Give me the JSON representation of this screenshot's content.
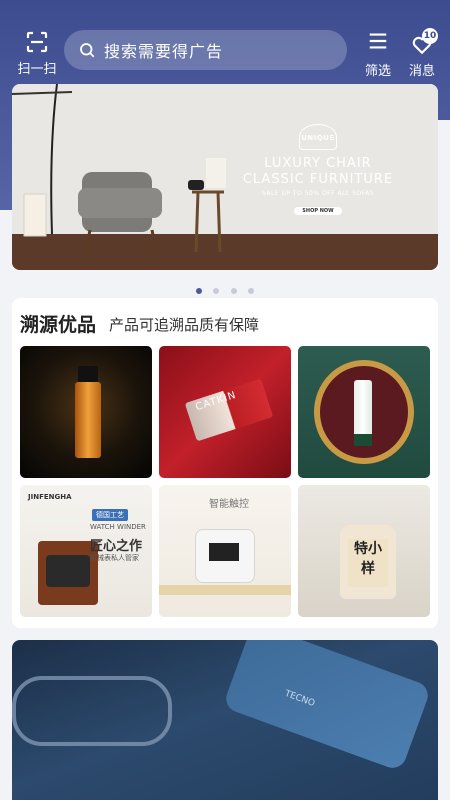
{
  "header": {
    "scan_label": "扫一扫",
    "search_placeholder": "搜索需要得广告",
    "filter_label": "筛选",
    "message_label": "消息",
    "message_badge": "10"
  },
  "banner": {
    "badge_text": "UNIQUE",
    "line1": "LUXURY CHAIR",
    "line2": "CLASSIC FURNITURE",
    "subline": "SALE UP TO 50% OFF ALL SOFAS",
    "button": "SHOP NOW",
    "dots_total": 4,
    "dots_active": 1
  },
  "section": {
    "title": "溯源优品",
    "subtitle": "产品可追溯品质有保障",
    "tiles": [
      {
        "name": "serum-product"
      },
      {
        "name": "lipstick-product",
        "text": "CATKIN"
      },
      {
        "name": "cream-product"
      },
      {
        "name": "watch-winder-product",
        "brand": "JINFENGHA",
        "tag": "德国工艺",
        "en": "WATCH WINDER",
        "title": "匠心之作",
        "sub": "机械表私人管家"
      },
      {
        "name": "cooker-product",
        "title": "智能触控"
      },
      {
        "name": "jar-product",
        "label": "特小样"
      }
    ]
  },
  "bottom_banner": {
    "brand": "TECNO"
  },
  "colors": {
    "header": "#3c4c8f",
    "accent": "#4a5a9c"
  }
}
